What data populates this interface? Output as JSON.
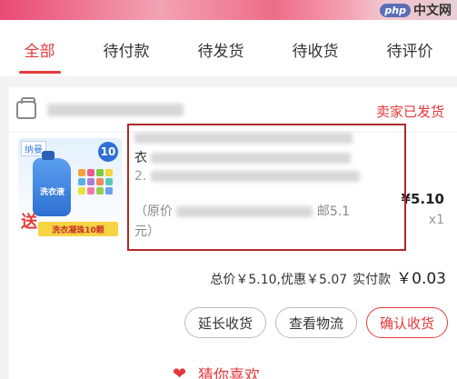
{
  "watermark": {
    "badge": "php",
    "text": "中文网"
  },
  "tabs": [
    {
      "label": "全部",
      "active": true
    },
    {
      "label": "待付款",
      "active": false
    },
    {
      "label": "待发货",
      "active": false
    },
    {
      "label": "待收货",
      "active": false
    },
    {
      "label": "待评价",
      "active": false
    }
  ],
  "order": {
    "status": "卖家已发货",
    "product": {
      "thumb_tag": "纳曼",
      "thumb_badge": "10",
      "thumb_bottle_label": "洗衣液",
      "thumb_send": "送",
      "thumb_strip": "洗衣凝珠10颗",
      "title_fragment_1": "衣",
      "title_fragment_2": "2.",
      "orig_price_prefix": "（原价",
      "orig_price_suffix": "邮5.1",
      "orig_price_end": "元）",
      "price": "¥5.10",
      "quantity": "x1"
    },
    "summary": {
      "total": "总价￥5.10,优惠￥5.07",
      "paid_label": "实付款",
      "paid_amount": "￥0.03"
    },
    "buttons": {
      "extend": "延长收货",
      "logistics": "查看物流",
      "confirm": "确认收货"
    }
  },
  "guess": {
    "label": "猜你喜欢"
  },
  "colors": {
    "accent": "#e4393c",
    "highlight_box": "#b0282c"
  }
}
